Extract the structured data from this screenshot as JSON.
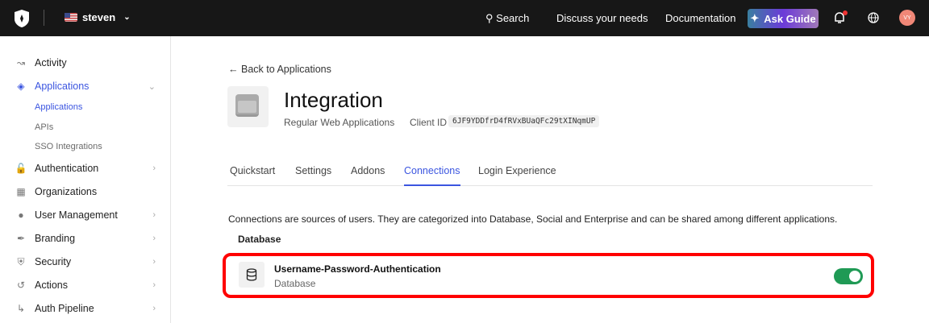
{
  "topbar": {
    "tenant": "steven",
    "search": "Search",
    "discuss": "Discuss your needs",
    "docs": "Documentation",
    "ask_guide": "Ask Guide",
    "avatar": "VY"
  },
  "sidebar": {
    "items": [
      {
        "label": "Activity",
        "icon": "activity-icon"
      },
      {
        "label": "Applications",
        "icon": "applications-icon",
        "sub": [
          "Applications",
          "APIs",
          "SSO Integrations"
        ]
      },
      {
        "label": "Authentication",
        "icon": "lock-icon"
      },
      {
        "label": "Organizations",
        "icon": "organizations-icon"
      },
      {
        "label": "User Management",
        "icon": "users-icon"
      },
      {
        "label": "Branding",
        "icon": "brush-icon"
      },
      {
        "label": "Security",
        "icon": "shield-icon"
      },
      {
        "label": "Actions",
        "icon": "actions-icon"
      },
      {
        "label": "Auth Pipeline",
        "icon": "pipeline-icon"
      }
    ]
  },
  "main": {
    "back": "Back to Applications",
    "title": "Integration",
    "app_type": "Regular Web Applications",
    "client_id_label": "Client ID",
    "client_id": "6JF9YDDfrD4fRVxBUaQFc29tXINqmUP",
    "tabs": [
      "Quickstart",
      "Settings",
      "Addons",
      "Connections",
      "Login Experience"
    ],
    "description": "Connections are sources of users. They are categorized into Database, Social and Enterprise and can be shared among different applications.",
    "section": "Database",
    "connection": {
      "name": "Username-Password-Authentication",
      "type": "Database",
      "enabled": true
    },
    "colors": {
      "accent": "#3b55e0",
      "toggle": "#1f9a55",
      "highlight": "#ff0000"
    }
  }
}
